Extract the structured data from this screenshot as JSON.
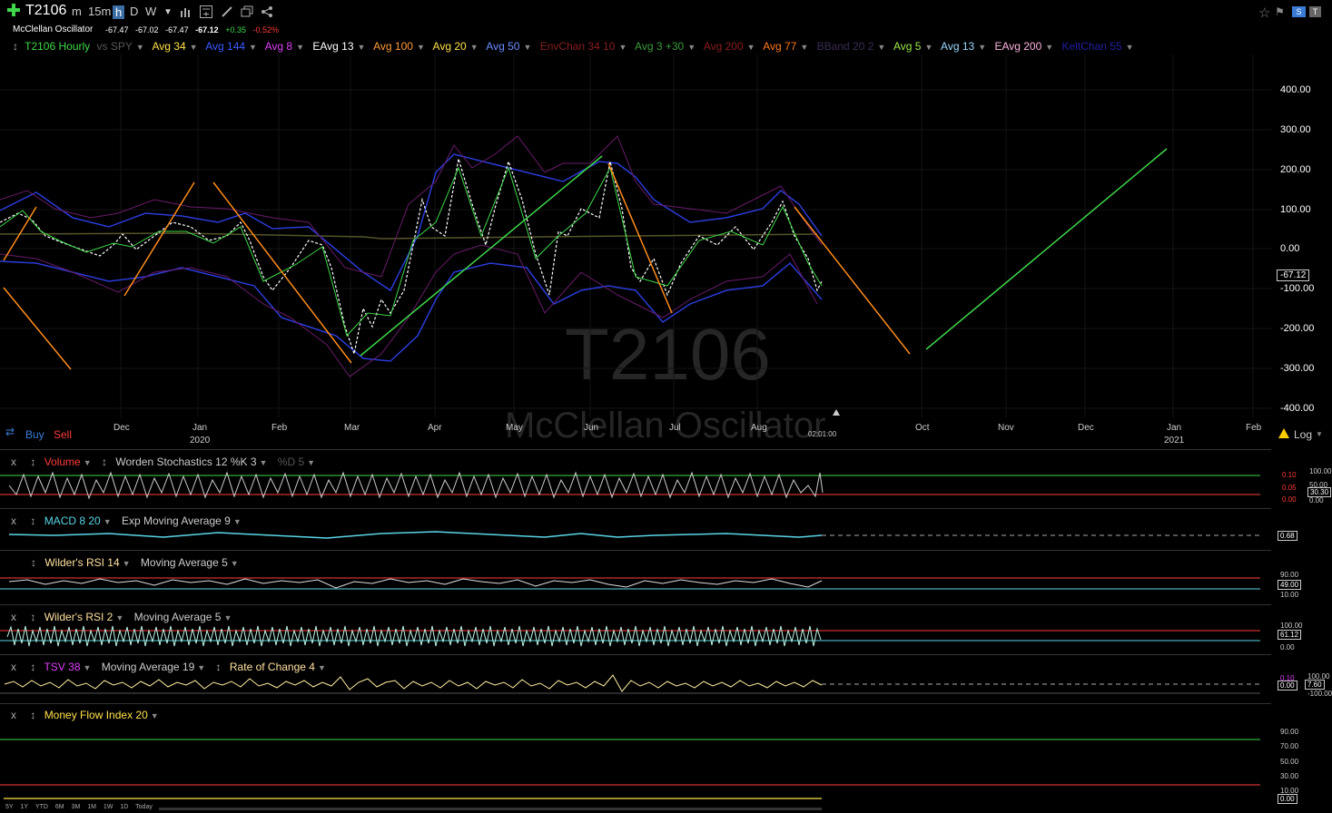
{
  "header": {
    "symbol": "T2106",
    "timeframes": [
      "m",
      "15m",
      "h",
      "D",
      "W"
    ],
    "selected_timeframe": "h",
    "subtitle": "McClellan Oscillator",
    "quote": {
      "open": "-67.47",
      "high": "-67.02",
      "low": "-67.47",
      "close": "-67.12",
      "change": "+0.35",
      "change_pct": "-0.52%"
    }
  },
  "indicators": [
    {
      "label": "T2106 Hourly",
      "color": "#3fd84a"
    },
    {
      "label": "vs SPY",
      "color": "#555"
    },
    {
      "label": "Avg 34",
      "color": "#ffe14a"
    },
    {
      "label": "Avg 144",
      "color": "#3a5bff"
    },
    {
      "label": "Avg 8",
      "color": "#e040fb"
    },
    {
      "label": "EAvg 13",
      "color": "#ffffff"
    },
    {
      "label": "Avg 100",
      "color": "#ff9b3a"
    },
    {
      "label": "Avg 20",
      "color": "#ffe14a"
    },
    {
      "label": "Avg 50",
      "color": "#6c8cff"
    },
    {
      "label": "EnvChan 34 10",
      "color": "#8a1e1e"
    },
    {
      "label": "Avg 3 +30",
      "color": "#3a9b3a"
    },
    {
      "label": "Avg 200",
      "color": "#8a1e1e"
    },
    {
      "label": "Avg 77",
      "color": "#ff7a1a"
    },
    {
      "label": "BBand 20 2",
      "color": "#3b2b55"
    },
    {
      "label": "Avg 5",
      "color": "#9be84a"
    },
    {
      "label": "Avg 13",
      "color": "#9bd8ff"
    },
    {
      "label": "EAvg 200",
      "color": "#ffb3e0"
    },
    {
      "label": "KeltChan 55",
      "color": "#2020a0"
    }
  ],
  "main_chart": {
    "watermark_symbol": "T2106",
    "watermark_name": "McClellan Oscillator",
    "y_labels": [
      "400.00",
      "300.00",
      "200.00",
      "100.00",
      "0.00",
      "-100.00",
      "-200.00",
      "-300.00",
      "-400.00"
    ],
    "current_value": "-67.12",
    "months": [
      "Dec",
      "Jan",
      "Feb",
      "Mar",
      "Apr",
      "May",
      "Jun",
      "Jul",
      "Aug",
      "Oct",
      "Nov",
      "Dec",
      "Jan",
      "Feb"
    ],
    "years": [
      "2020",
      "2021"
    ],
    "time_marker": "02:01:00",
    "buy_label": "Buy",
    "sell_label": "Sell",
    "log_label": "Log"
  },
  "panes": {
    "p1": {
      "x": "x",
      "items": [
        "Volume",
        "Worden Stochastics 12 %K 3",
        "%D 5"
      ],
      "labels_left": [
        "0.10",
        "0.05",
        "0.00"
      ],
      "labels_right": [
        "100.00",
        "50.00",
        "30.30",
        "0.00"
      ]
    },
    "p2": {
      "x": "x",
      "items": [
        "MACD 8 20",
        "Exp Moving Average 9"
      ],
      "value": "0.68"
    },
    "p3": {
      "x": "x",
      "items": [
        "Wilder's RSI 14",
        "Moving Average 5"
      ],
      "labels": [
        "90.00",
        "49.00",
        "10.00"
      ]
    },
    "p4": {
      "x": "x",
      "items": [
        "Wilder's RSI 2",
        "Moving Average 5"
      ],
      "labels": [
        "100.00",
        "61.12",
        "0.00"
      ]
    },
    "p5": {
      "x": "x",
      "items": [
        "TSV 38",
        "Moving Average 19",
        "Rate of Change 4"
      ],
      "labels": [
        "100.00",
        "7.60",
        "-100.00",
        "0.00",
        "0.10"
      ]
    },
    "p6": {
      "x": "x",
      "items": [
        "Money Flow Index 20"
      ],
      "labels": [
        "90.00",
        "70.00",
        "50.00",
        "30.00",
        "10.00",
        "0.00"
      ]
    }
  },
  "ranges": [
    "5Y",
    "1Y",
    "YTD",
    "6M",
    "3M",
    "1M",
    "1W",
    "1D",
    "Today"
  ]
}
